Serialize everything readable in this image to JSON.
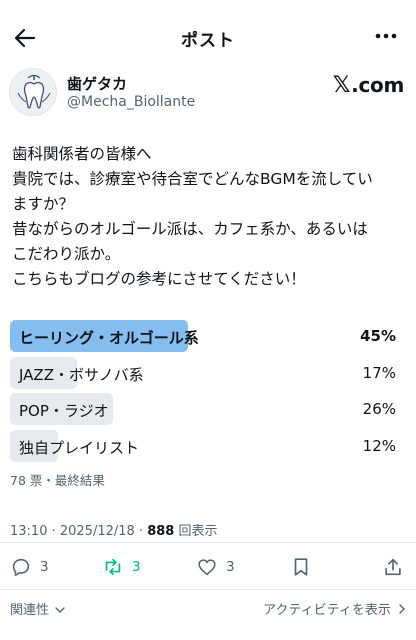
{
  "header": {
    "title": "ポスト",
    "back_icon": "arrow-left-icon",
    "more_icon": "more-horizontal-icon"
  },
  "author": {
    "display_name": "歯ゲタカ",
    "handle": "@Mecha_Biollante",
    "source_mark": "𝕏",
    "source_text": ".com"
  },
  "post": {
    "lines": [
      "歯科関係者の皆様へ",
      "貴院では、診療室や待合室でどんなBGMを流してい",
      "ますか？",
      "昔ながらのオルゴール派は、カフェ系か、あるいは",
      "こだわり派か。",
      "こちらもブログの参考にさせてください！"
    ]
  },
  "poll": {
    "options": [
      {
        "label": "ヒーリング・オルゴール系",
        "percent": 45,
        "percent_text": "45%"
      },
      {
        "label": "JAZZ・ボサノバ系",
        "percent": 17,
        "percent_text": "17%"
      },
      {
        "label": "POP・ラジオ",
        "percent": 26,
        "percent_text": "26%"
      },
      {
        "label": "独自プレイリスト",
        "percent": 12,
        "percent_text": "12%"
      }
    ],
    "meta": "78 票・最終結果"
  },
  "timestamp": {
    "prefix": "13:10 · 2025/12/18 · ",
    "views": "888",
    "views_suffix": " 回表示"
  },
  "actions": {
    "reply_count": "3",
    "retweet_count": "3",
    "like_count": "3"
  },
  "footer": {
    "related": "関連性",
    "activity": "アクティビティを表示"
  },
  "colors": {
    "winner_bar": "#85bdf0",
    "bar": "#e6e9ed",
    "muted_text": "#536471",
    "retweet_green": "#00ba7c"
  }
}
